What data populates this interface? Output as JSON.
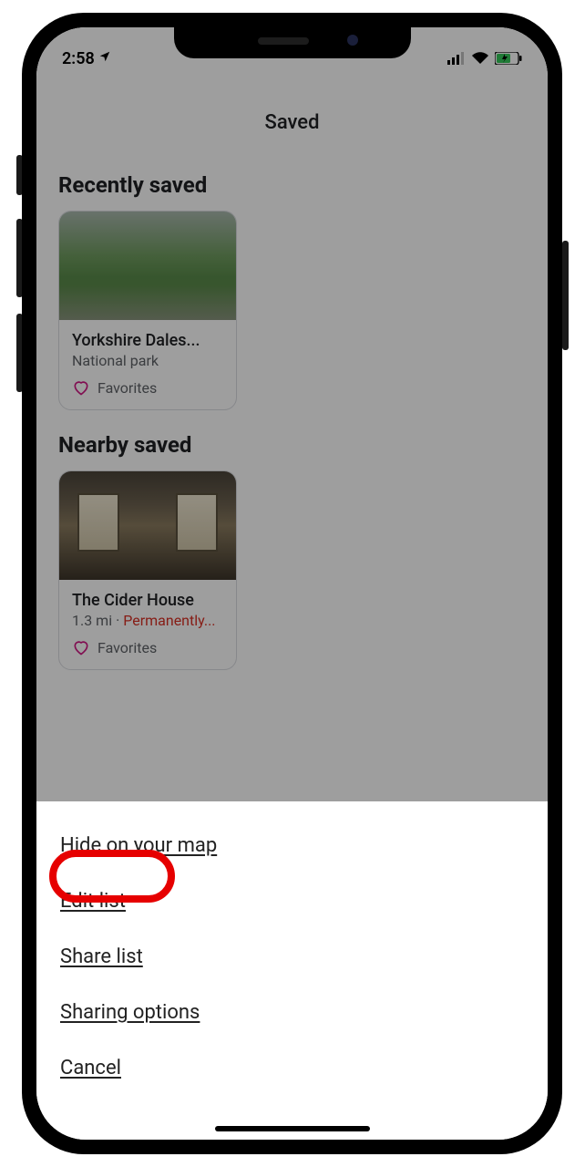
{
  "status": {
    "time": "2:58",
    "location_arrow": "➤"
  },
  "header": {
    "title": "Saved"
  },
  "sections": {
    "recent": {
      "title": "Recently saved",
      "card": {
        "title": "Yorkshire Dales...",
        "subtitle": "National park",
        "favorite_label": "Favorites"
      }
    },
    "nearby": {
      "title": "Nearby saved",
      "card": {
        "title": "The Cider House",
        "distance": "1.3 mi",
        "separator": "·",
        "status": "Permanently...",
        "favorite_label": "Favorites"
      }
    }
  },
  "sheet": {
    "hide": "Hide on your map",
    "edit": "Edit list",
    "share": "Share list",
    "sharing_options": "Sharing options",
    "cancel": "Cancel"
  }
}
